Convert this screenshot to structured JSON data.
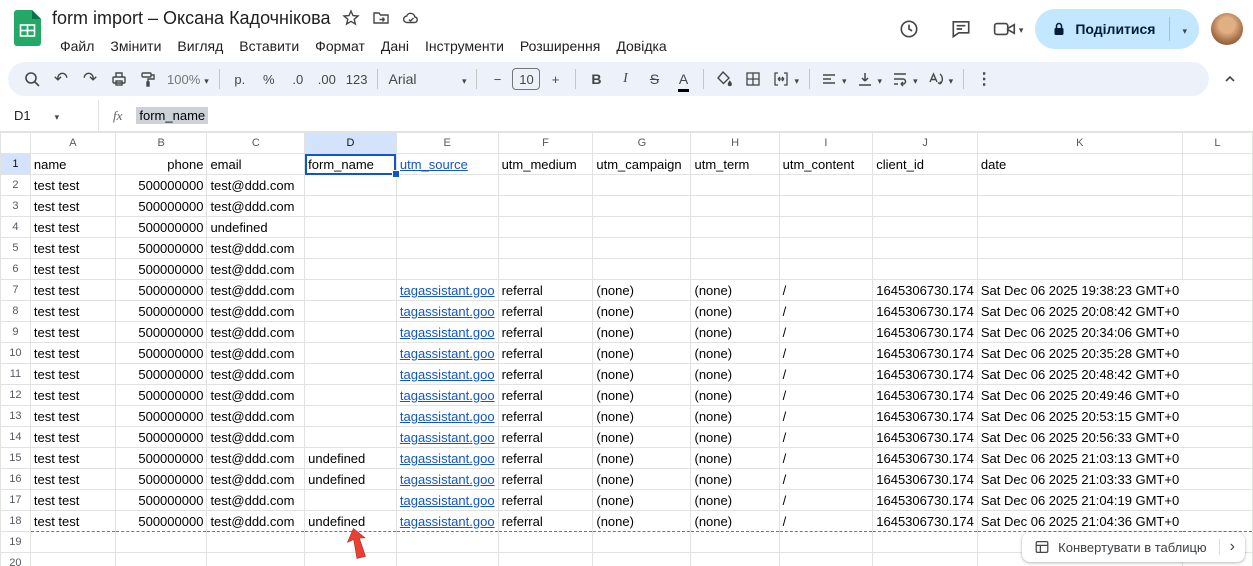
{
  "header": {
    "title": "form import – Оксана Кадочнікова",
    "menus": [
      "Файл",
      "Змінити",
      "Вигляд",
      "Вставити",
      "Формат",
      "Дані",
      "Інструменти",
      "Розширення",
      "Довідка"
    ],
    "share_label": "Поділитися"
  },
  "toolbar": {
    "zoom": "100%",
    "currency": "р.",
    "percent": "%",
    "decimal_decrease": ".0",
    "decimal_increase": ".00",
    "more_formats": "123",
    "font": "Arial",
    "minus": "−",
    "font_size": "10",
    "plus": "+",
    "bold": "B",
    "italic": "I",
    "strikethrough": "S",
    "text_color": "A"
  },
  "formula_bar": {
    "cell_ref": "D1",
    "fx": "fx",
    "value": "form_name"
  },
  "grid": {
    "columns": [
      "A",
      "B",
      "C",
      "D",
      "E",
      "F",
      "G",
      "H",
      "I",
      "J",
      "K",
      "L"
    ],
    "selected_column": "D",
    "selected_row": 1,
    "selected_cell": "D1",
    "visible_rows": 20,
    "dashed_bottom_row": 18,
    "rows": [
      [
        "name",
        "phone",
        "email",
        "form_name",
        "utm_source",
        "utm_medium",
        "utm_campaign",
        "utm_term",
        "utm_content",
        "client_id",
        "date",
        ""
      ],
      [
        "test test",
        "500000000",
        "test@ddd.com",
        "",
        "",
        "",
        "",
        "",
        "",
        "",
        "",
        ""
      ],
      [
        "test test",
        "500000000",
        "test@ddd.com",
        "",
        "",
        "",
        "",
        "",
        "",
        "",
        "",
        ""
      ],
      [
        "test test",
        "500000000",
        "undefined",
        "",
        "",
        "",
        "",
        "",
        "",
        "",
        "",
        ""
      ],
      [
        "test test",
        "500000000",
        "test@ddd.com",
        "",
        "",
        "",
        "",
        "",
        "",
        "",
        "",
        ""
      ],
      [
        "test test",
        "500000000",
        "test@ddd.com",
        "",
        "",
        "",
        "",
        "",
        "",
        "",
        "",
        ""
      ],
      [
        "test test",
        "500000000",
        "test@ddd.com",
        "",
        "tagassistant.goo",
        "referral",
        "(none)",
        "(none)",
        "/",
        "1645306730.174",
        "Sat Dec 06 2025 19:38:23 GMT+0",
        ""
      ],
      [
        "test test",
        "500000000",
        "test@ddd.com",
        "",
        "tagassistant.goo",
        "referral",
        "(none)",
        "(none)",
        "/",
        "1645306730.174",
        "Sat Dec 06 2025 20:08:42 GMT+0",
        ""
      ],
      [
        "test test",
        "500000000",
        "test@ddd.com",
        "",
        "tagassistant.goo",
        "referral",
        "(none)",
        "(none)",
        "/",
        "1645306730.174",
        "Sat Dec 06 2025 20:34:06 GMT+0",
        ""
      ],
      [
        "test test",
        "500000000",
        "test@ddd.com",
        "",
        "tagassistant.goo",
        "referral",
        "(none)",
        "(none)",
        "/",
        "1645306730.174",
        "Sat Dec 06 2025 20:35:28 GMT+0",
        ""
      ],
      [
        "test test",
        "500000000",
        "test@ddd.com",
        "",
        "tagassistant.goo",
        "referral",
        "(none)",
        "(none)",
        "/",
        "1645306730.174",
        "Sat Dec 06 2025 20:48:42 GMT+0",
        ""
      ],
      [
        "test test",
        "500000000",
        "test@ddd.com",
        "",
        "tagassistant.goo",
        "referral",
        "(none)",
        "(none)",
        "/",
        "1645306730.174",
        "Sat Dec 06 2025 20:49:46 GMT+0",
        ""
      ],
      [
        "test test",
        "500000000",
        "test@ddd.com",
        "",
        "tagassistant.goo",
        "referral",
        "(none)",
        "(none)",
        "/",
        "1645306730.174",
        "Sat Dec 06 2025 20:53:15 GMT+0",
        ""
      ],
      [
        "test test",
        "500000000",
        "test@ddd.com",
        "",
        "tagassistant.goo",
        "referral",
        "(none)",
        "(none)",
        "/",
        "1645306730.174",
        "Sat Dec 06 2025 20:56:33 GMT+0",
        ""
      ],
      [
        "test test",
        "500000000",
        "test@ddd.com",
        "undefined",
        "tagassistant.goo",
        "referral",
        "(none)",
        "(none)",
        "/",
        "1645306730.174",
        "Sat Dec 06 2025 21:03:13 GMT+0",
        ""
      ],
      [
        "test test",
        "500000000",
        "test@ddd.com",
        "undefined",
        "tagassistant.goo",
        "referral",
        "(none)",
        "(none)",
        "/",
        "1645306730.174",
        "Sat Dec 06 2025 21:03:33 GMT+0",
        ""
      ],
      [
        "test test",
        "500000000",
        "test@ddd.com",
        "",
        "tagassistant.goo",
        "referral",
        "(none)",
        "(none)",
        "/",
        "1645306730.174",
        "Sat Dec 06 2025 21:04:19 GMT+0",
        ""
      ],
      [
        "test test",
        "500000000",
        "test@ddd.com",
        "undefined",
        "tagassistant.goo",
        "referral",
        "(none)",
        "(none)",
        "/",
        "1645306730.174",
        "Sat Dec 06 2025 21:04:36 GMT+0",
        ""
      ],
      [
        "",
        "",
        "",
        "",
        "",
        "",
        "",
        "",
        "",
        "",
        "",
        ""
      ],
      [
        "",
        "",
        "",
        "",
        "",
        "",
        "",
        "",
        "",
        "",
        "",
        ""
      ]
    ]
  },
  "footer": {
    "convert_label": "Конвертувати в таблицю",
    "chevron": "›"
  },
  "annotation": {
    "arrow_color": "#e94235"
  }
}
